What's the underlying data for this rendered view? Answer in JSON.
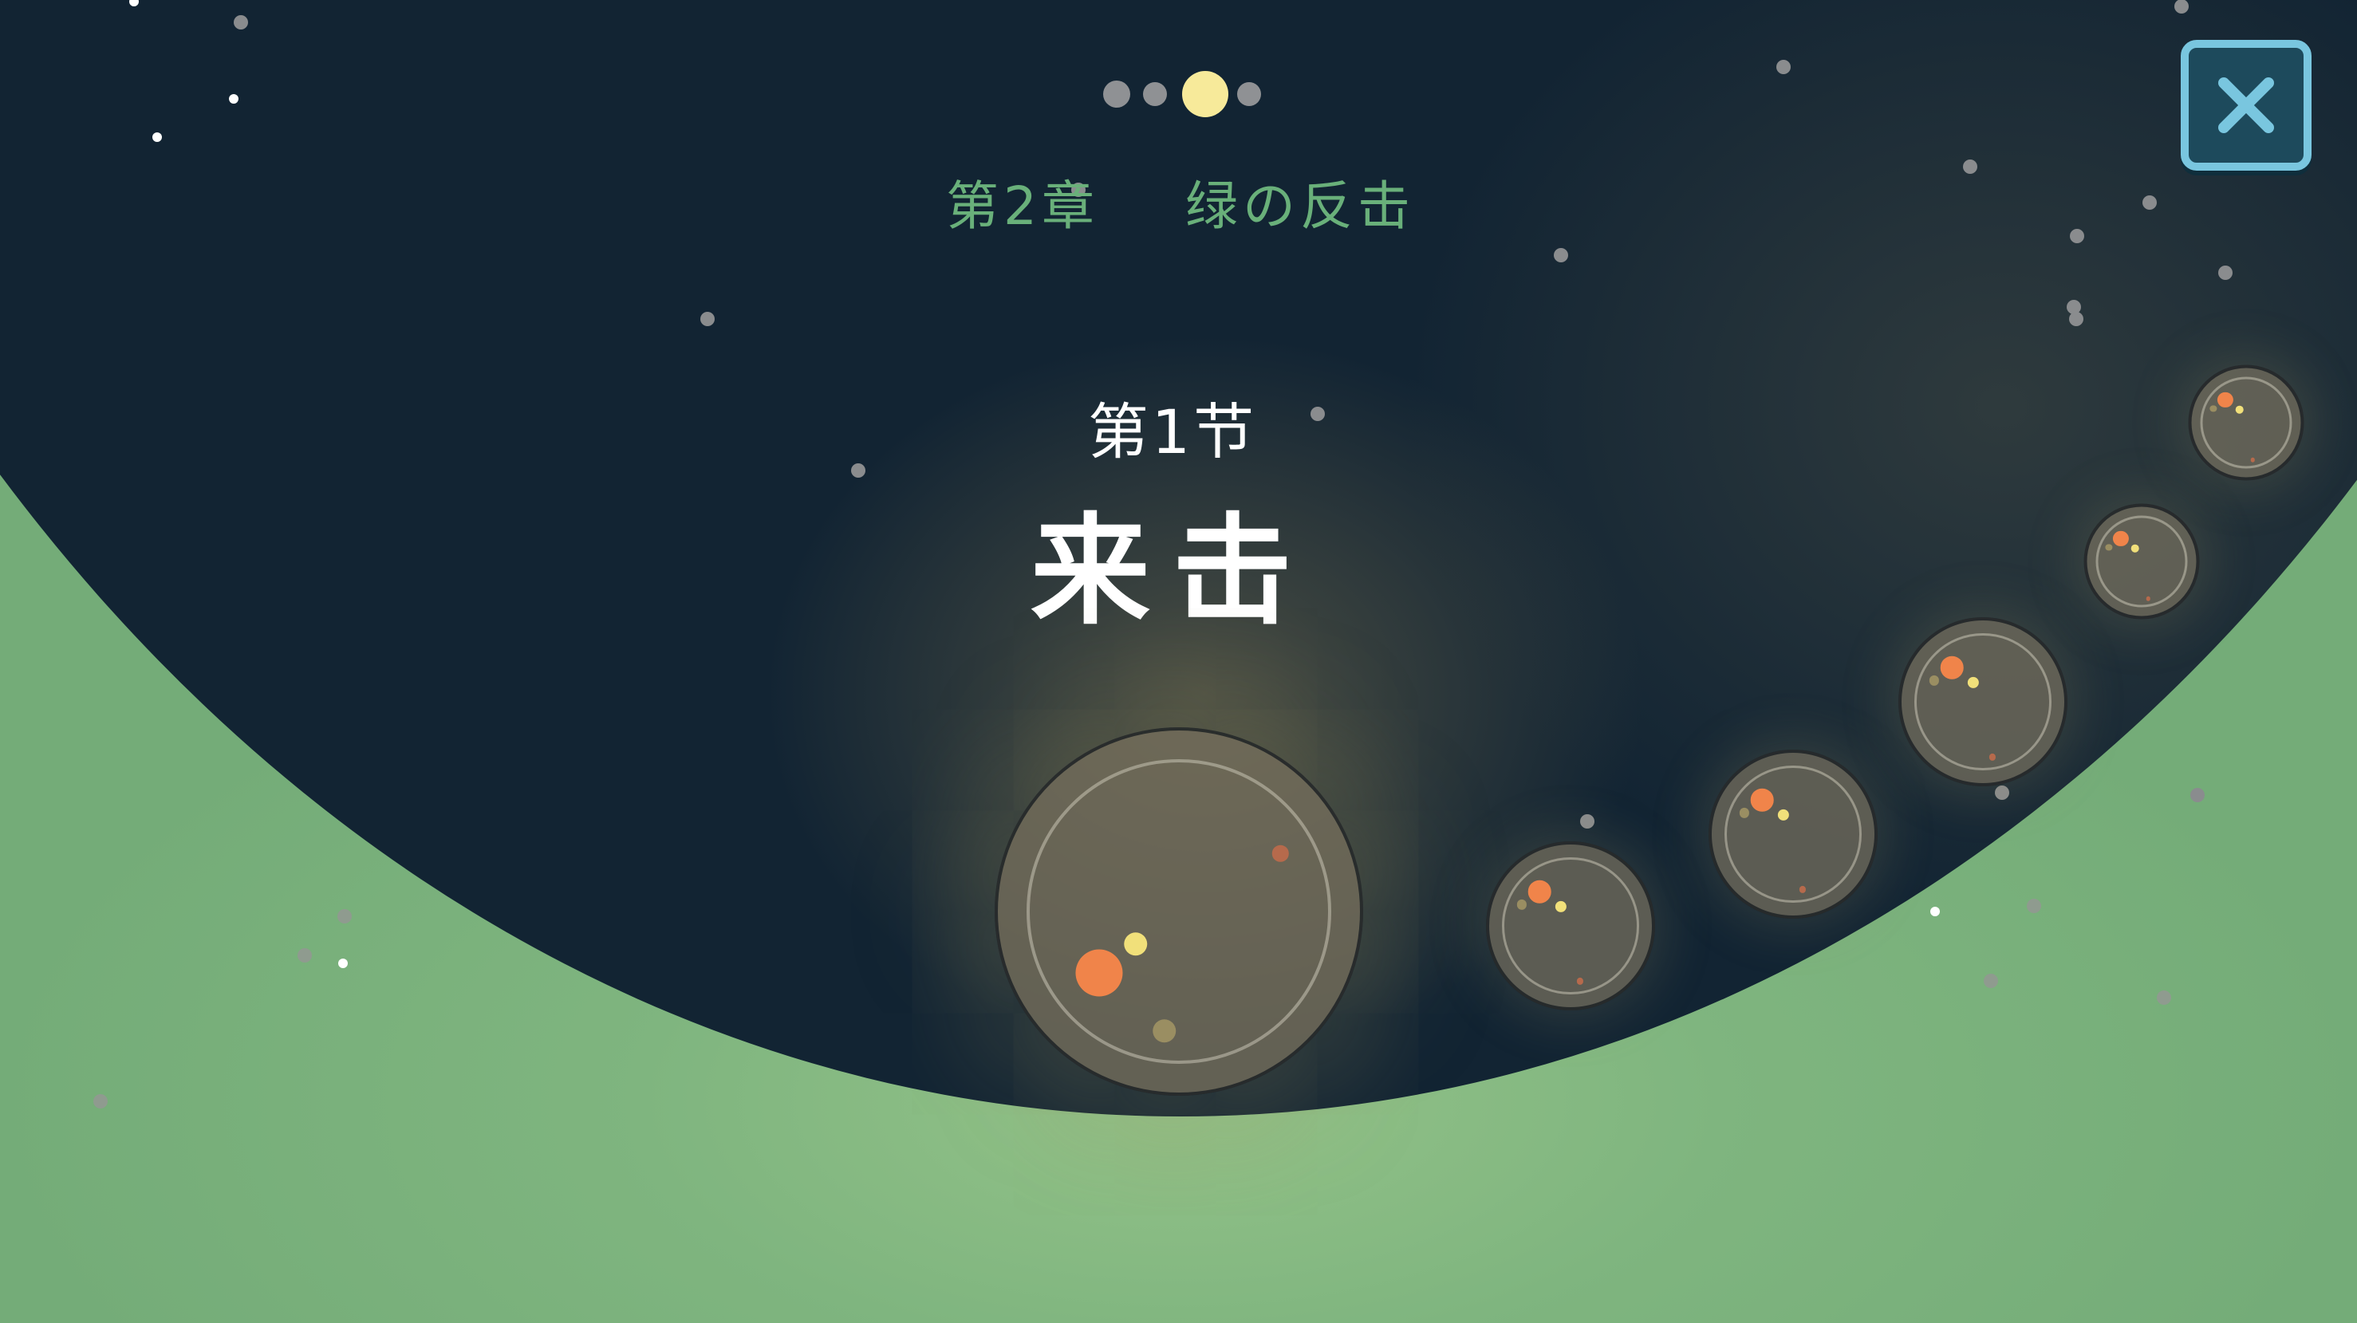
{
  "chapter_progress": {
    "total_pages": 4,
    "active_page": 3
  },
  "chapter": {
    "number_label": "第2章",
    "name": "绿の反击"
  },
  "section": {
    "number_label": "第1节",
    "title": "来击"
  },
  "close_button": {
    "icon": "close-icon"
  },
  "levels": [
    {
      "name": "level-node-1",
      "state": "current"
    },
    {
      "name": "level-node-2",
      "state": "locked"
    },
    {
      "name": "level-node-3",
      "state": "locked"
    },
    {
      "name": "level-node-4",
      "state": "locked"
    },
    {
      "name": "level-node-5",
      "state": "locked"
    },
    {
      "name": "level-node-6",
      "state": "locked"
    }
  ],
  "colors": {
    "space": "#122433",
    "ground": "#74ac78",
    "chapter_text": "#69b07a",
    "active_dot": "#f7ea9a",
    "close_border": "#79c6df",
    "cell_orange": "#f0844a",
    "cell_yellow": "#f1e07a",
    "cell_olive": "#9a8e62"
  }
}
